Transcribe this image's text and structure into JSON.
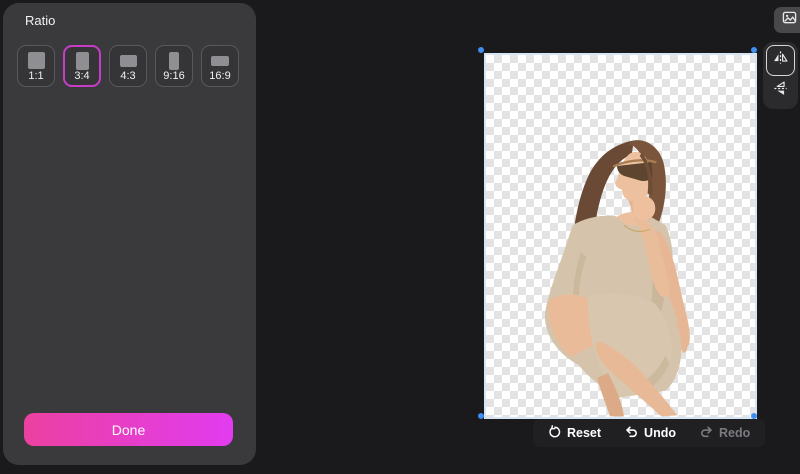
{
  "panel": {
    "title": "Ratio",
    "ratios": [
      {
        "label": "1:1",
        "selected": false
      },
      {
        "label": "3:4",
        "selected": true
      },
      {
        "label": "4:3",
        "selected": false
      },
      {
        "label": "9:16",
        "selected": false
      },
      {
        "label": "16:9",
        "selected": false
      }
    ],
    "done_label": "Done"
  },
  "canvas": {
    "selected_ratio": "3:4",
    "crop_handle_count": 4,
    "subject_description": "cutout photo of a woman in a beige sleeveless dress and sunglasses, seated with hand on chin, over transparent checkerboard"
  },
  "side_tools": {
    "buttons": [
      {
        "icon": "flip-horizontal-icon",
        "active": true
      },
      {
        "icon": "flip-vertical-icon",
        "active": false
      }
    ]
  },
  "top_right_button": {
    "icon": "image-icon"
  },
  "bottom_toolbar": {
    "reset_label": "Reset",
    "undo_label": "Undo",
    "redo_label": "Redo",
    "redo_disabled": true
  },
  "icons": {
    "reset": "reset-circular-arrow-icon",
    "undo": "undo-arrow-icon",
    "redo": "redo-arrow-icon"
  },
  "colors": {
    "accent_gradient_start": "#ec40a0",
    "accent_gradient_end": "#e13cf0",
    "selected_ratio_border": "#c73dc7",
    "crop_handle_blue": "#3f8ef0",
    "crop_border": "#d5e5f4",
    "panel_background": "#3a3a3c",
    "canvas_background": "#1a1a1c",
    "checker_light": "#ffffff",
    "checker_dark": "#e3e3e3"
  }
}
